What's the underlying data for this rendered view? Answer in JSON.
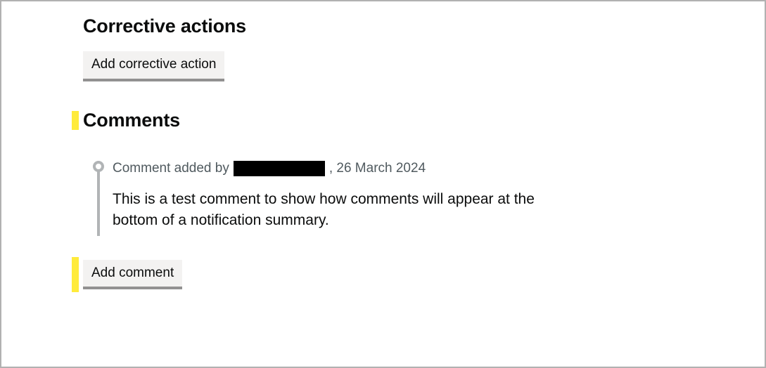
{
  "corrective": {
    "heading": "Corrective actions",
    "add_button": "Add corrective action"
  },
  "comments": {
    "heading": "Comments",
    "items": [
      {
        "meta_prefix": "Comment added by ",
        "author_redacted": true,
        "meta_suffix": ", 26 March 2024",
        "body": "This is a test comment to show how comments will appear at the bottom of a notification summary."
      }
    ],
    "add_button": "Add comment"
  }
}
